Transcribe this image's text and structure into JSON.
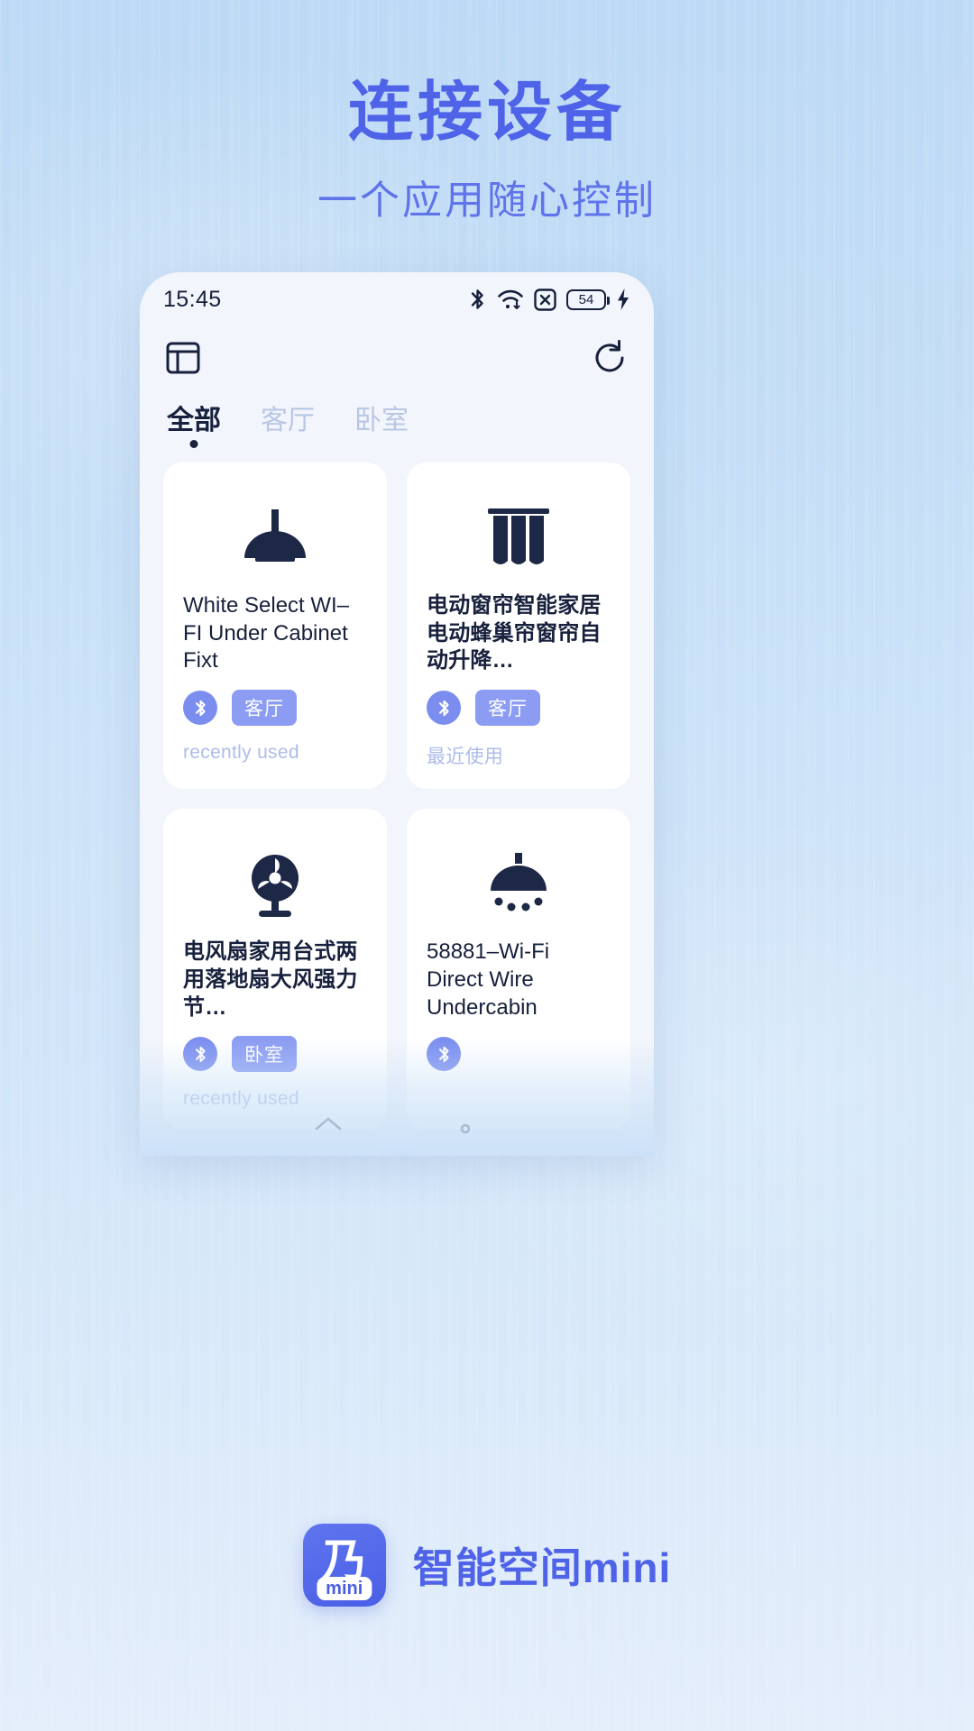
{
  "colors": {
    "accent": "#4f63e8",
    "accent_soft": "#8b9cf2",
    "ink": "#17203c",
    "muted": "#aebcea",
    "bg_top": "#bcd9f5",
    "bg_bottom": "#e3eefb"
  },
  "hero": {
    "headline": "连接设备",
    "subhead": "一个应用随心控制"
  },
  "phone": {
    "status_bar": {
      "time": "15:45",
      "battery_level": "54",
      "icons": [
        "bluetooth-icon",
        "wifi-icon",
        "no-signal-icon",
        "battery-icon",
        "charging-bolt-icon"
      ]
    },
    "toolbar": {
      "left_icon": "layout-panel-icon",
      "right_icon": "refresh-icon"
    },
    "tabs": [
      {
        "label": "全部",
        "active": true
      },
      {
        "label": "客厅",
        "active": false
      },
      {
        "label": "卧室",
        "active": false
      }
    ],
    "devices": [
      {
        "icon": "pendant-lamp-icon",
        "title": "White Select WI–FI Under Cabinet Fixt",
        "is_cjk": false,
        "protocol": "bluetooth-icon",
        "room": "客厅",
        "meta": "recently used"
      },
      {
        "icon": "curtain-icon",
        "title": "电动窗帘智能家居电动蜂巢帘窗帘自动升降…",
        "is_cjk": true,
        "protocol": "bluetooth-icon",
        "room": "客厅",
        "meta": "最近使用"
      },
      {
        "icon": "fan-icon",
        "title": "电风扇家用台式两用落地扇大风强力节…",
        "is_cjk": true,
        "protocol": "bluetooth-icon",
        "room": "卧室",
        "meta": "recently used"
      },
      {
        "icon": "ceiling-light-icon",
        "title": "58881–Wi-Fi Direct Wire Undercabin",
        "is_cjk": false,
        "protocol": "bluetooth-icon",
        "room": "",
        "meta": ""
      },
      {
        "icon": "air-conditioner-icon",
        "title": "",
        "is_cjk": false,
        "protocol": "",
        "room": "",
        "meta": ""
      },
      {
        "icon": "pendant-lamp-icon",
        "title": "",
        "is_cjk": false,
        "protocol": "",
        "room": "",
        "meta": ""
      }
    ]
  },
  "brand": {
    "logo_glyph": "乃",
    "logo_badge": "mini",
    "name": "智能空间mini"
  }
}
